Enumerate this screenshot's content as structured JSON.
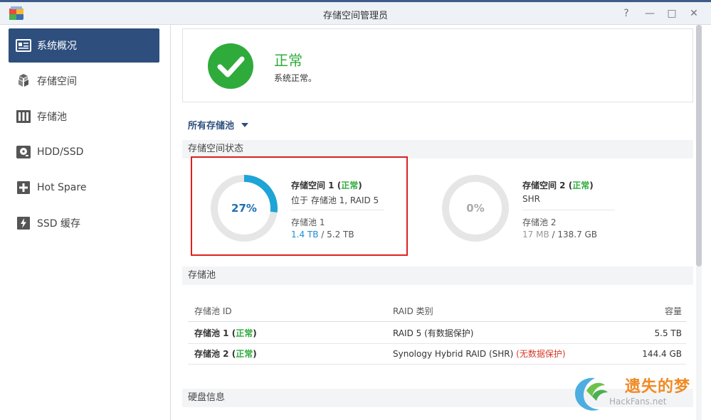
{
  "window": {
    "title": "存储空间管理员",
    "help": "?",
    "minimize": "—",
    "maximize": "□",
    "close": "✕"
  },
  "sidebar": {
    "items": [
      {
        "label": "系统概况",
        "icon": "overview-icon",
        "active": true
      },
      {
        "label": "存储空间",
        "icon": "volume-icon",
        "active": false
      },
      {
        "label": "存储池",
        "icon": "storage-pool-icon",
        "active": false
      },
      {
        "label": "HDD/SSD",
        "icon": "disk-icon",
        "active": false
      },
      {
        "label": "Hot Spare",
        "icon": "hot-spare-icon",
        "active": false
      },
      {
        "label": "SSD 缓存",
        "icon": "ssd-cache-icon",
        "active": false
      }
    ]
  },
  "status": {
    "title": "正常",
    "description": "系统正常。",
    "color": "#2fab3c"
  },
  "pool_filter": {
    "label": "所有存储池"
  },
  "sections": {
    "volume_status": "存储空间状态",
    "storage_pool": "存储池",
    "disk_info": "硬盘信息"
  },
  "volumes": [
    {
      "name": "存储空间 1",
      "status": "正常",
      "percent_label": "27%",
      "usage_fraction": 0.27,
      "location": "位于 存储池 1, RAID 5",
      "pool": "存储池 1",
      "used": "1.4 TB",
      "separator": " / ",
      "total": "5.2 TB",
      "ring_color": "#1ea4d6"
    },
    {
      "name": "存储空间 2",
      "status": "正常",
      "percent_label": "0%",
      "usage_fraction": 0,
      "location": "SHR",
      "pool": "存储池 2",
      "used": "17 MB",
      "separator": " / ",
      "total": "138.7 GB",
      "ring_color": "#1ea4d6"
    }
  ],
  "pool_table": {
    "headers": [
      "存储池 ID",
      "RAID 类别",
      "容量"
    ],
    "rows": [
      {
        "name": "存储池 1",
        "status": "正常",
        "raid": "RAID 5",
        "raid_note": "(有数据保护)",
        "capacity": "5.5 TB"
      },
      {
        "name": "存储池 2",
        "status": "正常",
        "raid": "Synology Hybrid RAID (SHR)",
        "raid_note": "(无数据保护)",
        "capacity": "144.4 GB"
      }
    ]
  },
  "watermark": {
    "text": "遗失的梦",
    "url": "HackFans.net"
  },
  "colors": {
    "accent": "#2e4f7d",
    "ok": "#2fab3c",
    "warn": "#d63b2b",
    "highlight": "#e02020"
  }
}
